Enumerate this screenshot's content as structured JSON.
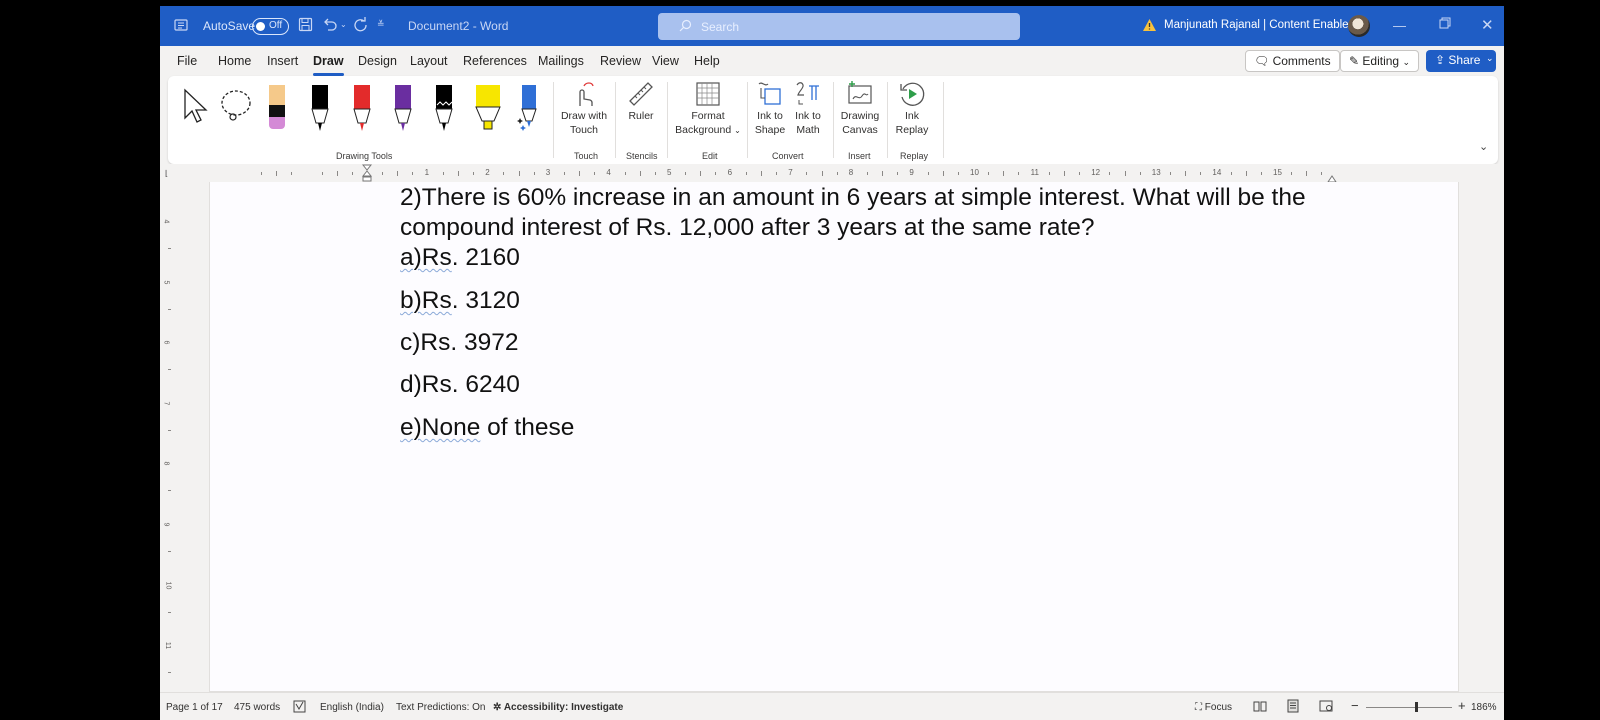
{
  "titlebar": {
    "autosave_label": "AutoSave",
    "autosave_state": "Off",
    "document_title": "Document2  -  Word",
    "search_placeholder": "Search",
    "user_name": "Manjunath Rajanal | Content Enablers",
    "brand_color": "#1f5dc5"
  },
  "menu": {
    "tabs": [
      "File",
      "Home",
      "Insert",
      "Draw",
      "Design",
      "Layout",
      "References",
      "Mailings",
      "Review",
      "View",
      "Help"
    ],
    "active_tab": "Draw",
    "comments_label": "Comments",
    "editing_label": "Editing",
    "share_label": "Share"
  },
  "ribbon": {
    "groups": {
      "drawing_tools": "Drawing Tools",
      "touch": "Touch",
      "stencils": "Stencils",
      "edit": "Edit",
      "convert": "Convert",
      "insert": "Insert",
      "replay": "Replay"
    },
    "buttons": {
      "draw_with_touch_1": "Draw with",
      "draw_with_touch_2": "Touch",
      "ruler": "Ruler",
      "format_bg_1": "Format",
      "format_bg_2": "Background",
      "ink_to_shape_1": "Ink to",
      "ink_to_shape_2": "Shape",
      "ink_to_math_1": "Ink to",
      "ink_to_math_2": "Math",
      "drawing_canvas_1": "Drawing",
      "drawing_canvas_2": "Canvas",
      "ink_replay_1": "Ink",
      "ink_replay_2": "Replay"
    },
    "pen_colors": [
      "#000000",
      "#e32b2b",
      "#6a2ea0",
      "#000000",
      "#f7e600",
      "#2f6fd6"
    ]
  },
  "ruler": {
    "h_numbers": [
      "1",
      "2",
      "3",
      "4",
      "5",
      "6",
      "7",
      "8",
      "9",
      "10",
      "11",
      "12",
      "13",
      "14",
      "15"
    ],
    "v_numbers": [
      "4",
      "5",
      "6",
      "7",
      "8",
      "9",
      "10",
      "11"
    ]
  },
  "document": {
    "question_line1": "2)There is 60% increase in an amount in 6 years at simple interest. What will be the",
    "question_line2": "compound interest of Rs. 12,000 after 3 years at the same rate?",
    "options": [
      {
        "prefix": "a)Rs",
        "rest": ". 2160"
      },
      {
        "prefix": "b)Rs",
        "rest": ". 3120"
      },
      {
        "prefix": "c)Rs. 3972",
        "rest": ""
      },
      {
        "prefix": "d)Rs. 6240",
        "rest": ""
      },
      {
        "prefix": "e)None",
        "rest": " of these"
      }
    ]
  },
  "status": {
    "page": "Page 1 of 17",
    "words": "475 words",
    "language": "English (India)",
    "text_predictions": "Text Predictions: On",
    "accessibility": "Accessibility: Investigate",
    "focus": "Focus",
    "zoom": "186%",
    "zoom_level_fraction": 0.58
  }
}
